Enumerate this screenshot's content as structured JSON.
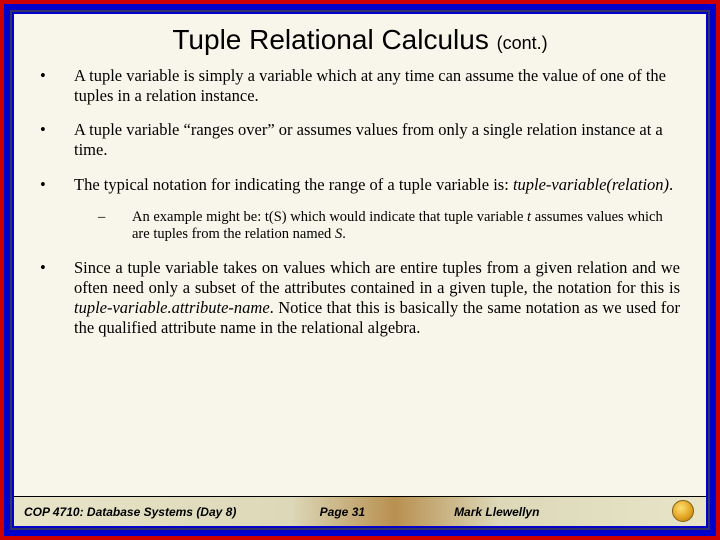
{
  "title": {
    "main": "Tuple Relational Calculus",
    "cont": "(cont.)"
  },
  "bullets": {
    "b1": "A tuple variable is simply a variable which at any time can assume the value of one of the tuples in a relation instance.",
    "b2": "A tuple variable “ranges over” or assumes values from only a single relation instance at a time.",
    "b3_a": "The typical notation for indicating the range of a tuple variable is: ",
    "b3_b": "tuple-variable(relation)",
    "b3_c": ".",
    "sub_a": "An example might be: t(S) which would indicate that tuple variable ",
    "sub_b": "t",
    "sub_c": " assumes values which are tuples from the relation named ",
    "sub_d": "S",
    "sub_e": ".",
    "b4_a": "Since a tuple variable takes on values which are entire tuples from a given relation and we often need only a subset of the attributes contained in a given tuple, the notation for this is ",
    "b4_b": "tuple-variable.attribute-name",
    "b4_c": ".   Notice that this is basically the same notation as we used for the qualified attribute name in the relational algebra."
  },
  "footer": {
    "course": "COP 4710: Database Systems (Day 8)",
    "page": "Page 31",
    "author": "Mark Llewellyn"
  }
}
